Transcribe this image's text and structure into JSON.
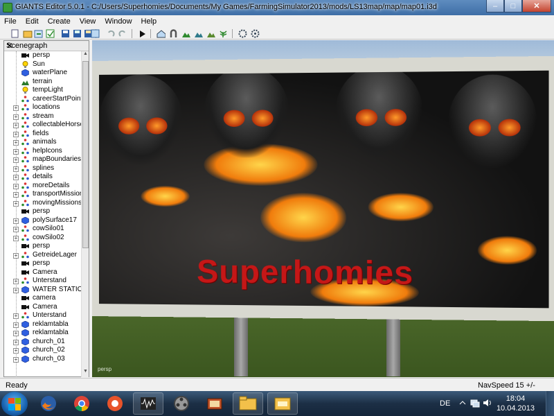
{
  "window": {
    "title": "GIANTS Editor 5.0.1 - C:/Users/Superhomies/Documents/My Games/FarmingSimulator2013/mods/LS13map/map/map01.i3d",
    "minimize": "–",
    "maximize": "□",
    "close": "✕"
  },
  "menu": [
    "File",
    "Edit",
    "Create",
    "View",
    "Window",
    "Help"
  ],
  "toolbar": [
    "new-file-icon",
    "open-icon",
    "import-icon",
    "cut-icon",
    "save-icon",
    "save-as-icon",
    "save-all-icon",
    "select-icon",
    "undo-icon",
    "redo-icon",
    "play-icon",
    "camera-home-icon",
    "magnet-icon",
    "terrain-sculpt-icon",
    "terrain-paint-icon",
    "foliage-paint-icon",
    "foliage-icon",
    "settings-icon",
    "settings2-icon"
  ],
  "scenegraph": {
    "title": "Scenegraph",
    "close": "✕",
    "items": [
      {
        "label": "persp",
        "icon": "camera",
        "expand": false
      },
      {
        "label": "Sun",
        "icon": "light",
        "expand": false
      },
      {
        "label": "waterPlane",
        "icon": "cube",
        "expand": false
      },
      {
        "label": "terrain",
        "icon": "terrain",
        "expand": false
      },
      {
        "label": "tempLight",
        "icon": "light",
        "expand": false
      },
      {
        "label": "careerStartPoint",
        "icon": "transform",
        "expand": false
      },
      {
        "label": "locations",
        "icon": "transform",
        "expand": true
      },
      {
        "label": "stream",
        "icon": "transform",
        "expand": true
      },
      {
        "label": "collectableHorses",
        "icon": "transform",
        "expand": true
      },
      {
        "label": "fields",
        "icon": "transform",
        "expand": true
      },
      {
        "label": "animals",
        "icon": "transform",
        "expand": true
      },
      {
        "label": "helpIcons",
        "icon": "transform",
        "expand": true
      },
      {
        "label": "mapBoundaries",
        "icon": "transform",
        "expand": true
      },
      {
        "label": "splines",
        "icon": "transform",
        "expand": true
      },
      {
        "label": "details",
        "icon": "transform",
        "expand": true
      },
      {
        "label": "moreDetails",
        "icon": "transform",
        "expand": true
      },
      {
        "label": "transportMissions",
        "icon": "transform",
        "expand": true
      },
      {
        "label": "movingMissions",
        "icon": "transform",
        "expand": true
      },
      {
        "label": "persp",
        "icon": "camera",
        "expand": false
      },
      {
        "label": "polySurface17",
        "icon": "cube",
        "expand": true
      },
      {
        "label": "cowSilo01",
        "icon": "transform",
        "expand": true
      },
      {
        "label": "cowSilo02",
        "icon": "transform",
        "expand": true
      },
      {
        "label": "persp",
        "icon": "camera",
        "expand": false
      },
      {
        "label": "GetreideLager",
        "icon": "transform",
        "expand": true
      },
      {
        "label": "persp",
        "icon": "camera",
        "expand": false
      },
      {
        "label": "Camera",
        "icon": "camera",
        "expand": false
      },
      {
        "label": "Unterstand",
        "icon": "transform",
        "expand": true
      },
      {
        "label": "WATER STATION",
        "icon": "cube",
        "expand": true
      },
      {
        "label": "camera",
        "icon": "camera",
        "expand": false
      },
      {
        "label": "Camera",
        "icon": "camera",
        "expand": false
      },
      {
        "label": "Unterstand",
        "icon": "transform",
        "expand": true
      },
      {
        "label": "reklamtabla",
        "icon": "cube",
        "expand": true
      },
      {
        "label": "reklamtabla",
        "icon": "cube",
        "expand": true
      },
      {
        "label": "church_01",
        "icon": "cube",
        "expand": true
      },
      {
        "label": "church_02",
        "icon": "cube",
        "expand": true
      },
      {
        "label": "church_03",
        "icon": "cube",
        "expand": true
      }
    ]
  },
  "viewport": {
    "label": "persp",
    "billboard_text": "Superhomies"
  },
  "status": {
    "left": "Ready",
    "right": "NavSpeed 15 +/-"
  },
  "taskbar": {
    "apps": [
      "firefox-icon",
      "chrome-icon",
      "media-player-icon",
      "audio-editor-icon",
      "video-icon",
      "movie-maker-icon",
      "explorer-icon",
      "giants-editor-icon"
    ],
    "language": "DE",
    "time": "18:04",
    "date": "10.04.2013"
  },
  "colors": {
    "title_bar": "#4a7ab0",
    "accent_red": "#c51717"
  }
}
